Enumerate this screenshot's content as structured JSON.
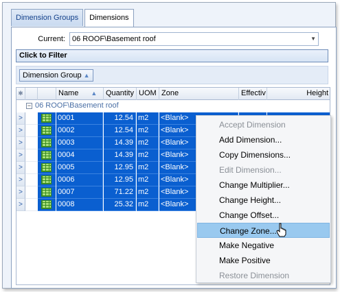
{
  "tabs": [
    {
      "label": "Dimension Groups",
      "active": false
    },
    {
      "label": "Dimensions",
      "active": true
    }
  ],
  "current": {
    "label": "Current:",
    "value": "06 ROOF\\Basement roof"
  },
  "filter": {
    "label": "Click to Filter"
  },
  "group_by": {
    "chip_label": "Dimension Group"
  },
  "grid": {
    "columns": [
      "Name",
      "Quantity",
      "UOM",
      "Zone",
      "Effectiv",
      "Height"
    ],
    "group_row": "06 ROOF\\Basement roof",
    "rows": [
      {
        "name": "0001",
        "quantity": "12.54",
        "uom": "m2",
        "zone": "<Blank>"
      },
      {
        "name": "0002",
        "quantity": "12.54",
        "uom": "m2",
        "zone": "<Blank>"
      },
      {
        "name": "0003",
        "quantity": "14.39",
        "uom": "m2",
        "zone": "<Blank>"
      },
      {
        "name": "0004",
        "quantity": "14.39",
        "uom": "m2",
        "zone": "<Blank>"
      },
      {
        "name": "0005",
        "quantity": "12.95",
        "uom": "m2",
        "zone": "<Blank>"
      },
      {
        "name": "0006",
        "quantity": "12.95",
        "uom": "m2",
        "zone": "<Blank>"
      },
      {
        "name": "0007",
        "quantity": "71.22",
        "uom": "m2",
        "zone": "<Blank>"
      },
      {
        "name": "0008",
        "quantity": "25.32",
        "uom": "m2",
        "zone": "<Blank>"
      }
    ]
  },
  "context_menu": {
    "items": [
      {
        "label": "Accept Dimension",
        "enabled": false
      },
      {
        "label": "Add Dimension...",
        "enabled": true
      },
      {
        "label": "Copy Dimensions...",
        "enabled": true
      },
      {
        "label": "Edit Dimension...",
        "enabled": false
      },
      {
        "label": "Change Multiplier...",
        "enabled": true
      },
      {
        "label": "Change Height...",
        "enabled": true
      },
      {
        "label": "Change Offset...",
        "enabled": true
      },
      {
        "label": "Change Zone...",
        "enabled": true,
        "highlighted": true
      },
      {
        "label": "Make Negative",
        "enabled": true
      },
      {
        "label": "Make Positive",
        "enabled": true
      },
      {
        "label": "Restore Dimension",
        "enabled": false
      }
    ]
  },
  "colors": {
    "selection": "#0a5fd0",
    "menu_highlight": "#99c9ef"
  }
}
